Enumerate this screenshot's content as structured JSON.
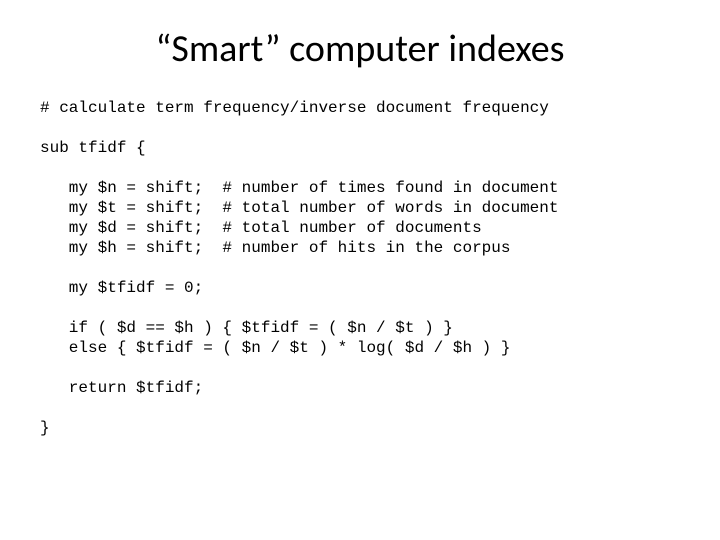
{
  "title": "“Smart” computer indexes",
  "code": {
    "c0": "# calculate term frequency/inverse document frequency",
    "c1": "",
    "c2": "sub tfidf {",
    "c3": "",
    "c4": "   my $n = shift;  # number of times found in document",
    "c5": "   my $t = shift;  # total number of words in document",
    "c6": "   my $d = shift;  # total number of documents",
    "c7": "   my $h = shift;  # number of hits in the corpus",
    "c8": "",
    "c9": "   my $tfidf = 0;",
    "c10": "",
    "c11": "   if ( $d == $h ) { $tfidf = ( $n / $t ) }",
    "c12": "   else { $tfidf = ( $n / $t ) * log( $d / $h ) }",
    "c13": "",
    "c14": "   return $tfidf;",
    "c15": "",
    "c16": "}"
  }
}
